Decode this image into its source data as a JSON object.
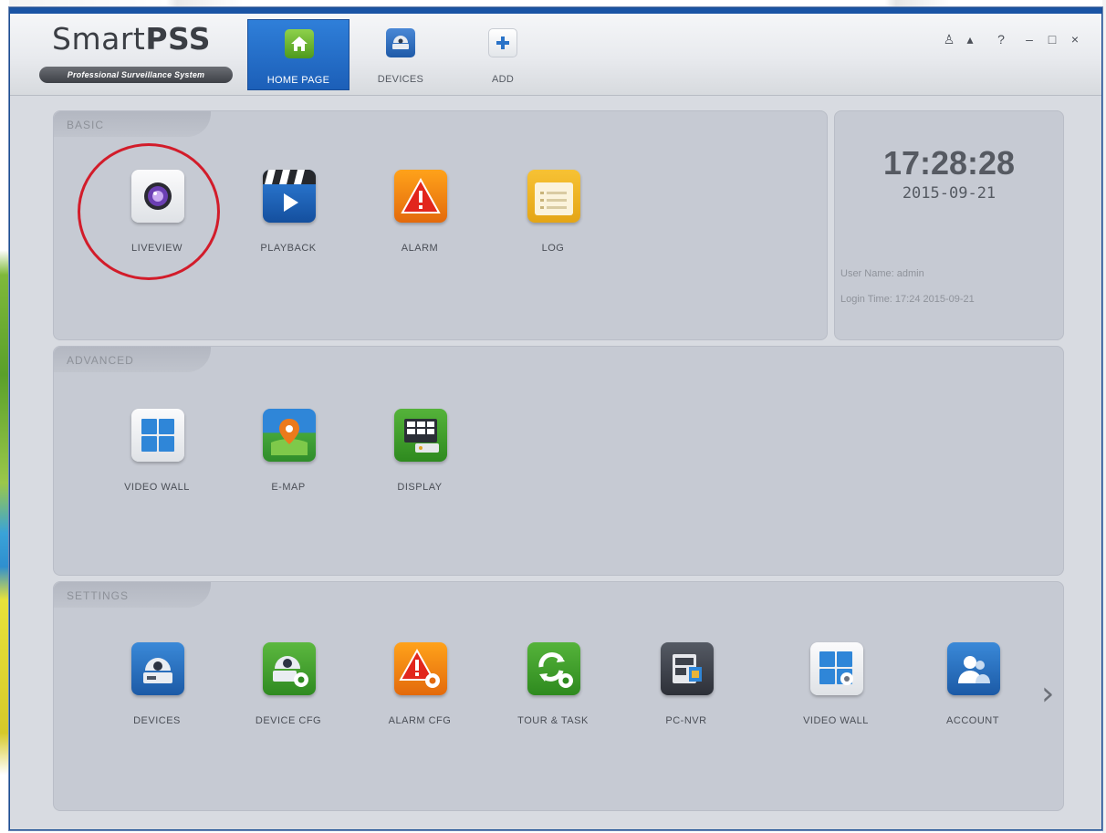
{
  "app": {
    "logo_main": "Smart",
    "logo_bold": "PSS",
    "logo_tagline": "Professional Surveillance System"
  },
  "nav_tabs": [
    {
      "label": "HOME PAGE",
      "icon": "home-icon",
      "active": true
    },
    {
      "label": "DEVICES",
      "icon": "device-icon",
      "active": false
    },
    {
      "label": "ADD",
      "icon": "plus-icon",
      "active": false
    }
  ],
  "window_controls": [
    "user-icon",
    "lock-icon",
    "help-icon",
    "minimize-icon",
    "maximize-icon",
    "close-icon"
  ],
  "window_control_glyphs": [
    "♙",
    "▴",
    "?",
    "–",
    "□",
    "×"
  ],
  "basic": {
    "title": "BASIC",
    "items": [
      {
        "label": "LIVEVIEW",
        "icon": "camera-lens-icon"
      },
      {
        "label": "PLAYBACK",
        "icon": "clapper-play-icon"
      },
      {
        "label": "ALARM",
        "icon": "alarm-warning-icon"
      },
      {
        "label": "LOG",
        "icon": "log-notepad-icon"
      }
    ]
  },
  "info": {
    "time": "17:28:28",
    "date": "2015-09-21",
    "user_line": "User Name: admin",
    "login_line": "Login Time: 17:24 2015-09-21"
  },
  "advanced": {
    "title": "ADVANCED",
    "items": [
      {
        "label": "VIDEO WALL",
        "icon": "video-wall-grid-icon"
      },
      {
        "label": "E-MAP",
        "icon": "map-pin-icon"
      },
      {
        "label": "DISPLAY",
        "icon": "display-icon"
      }
    ]
  },
  "settings": {
    "title": "SETTINGS",
    "items": [
      {
        "label": "DEVICES",
        "icon": "dome-camera-icon"
      },
      {
        "label": "DEVICE CFG",
        "icon": "device-config-icon"
      },
      {
        "label": "ALARM CFG",
        "icon": "alarm-config-icon"
      },
      {
        "label": "TOUR & TASK",
        "icon": "tour-task-icon"
      },
      {
        "label": "PC-NVR",
        "icon": "pc-nvr-icon"
      },
      {
        "label": "VIDEO WALL",
        "icon": "video-wall-config-icon"
      },
      {
        "label": "ACCOUNT",
        "icon": "account-icon"
      }
    ],
    "next_glyph": "›"
  },
  "colors": {
    "accent": "#1c5fb8",
    "highlight": "#d21c2a",
    "panel": "#c6cad3"
  }
}
